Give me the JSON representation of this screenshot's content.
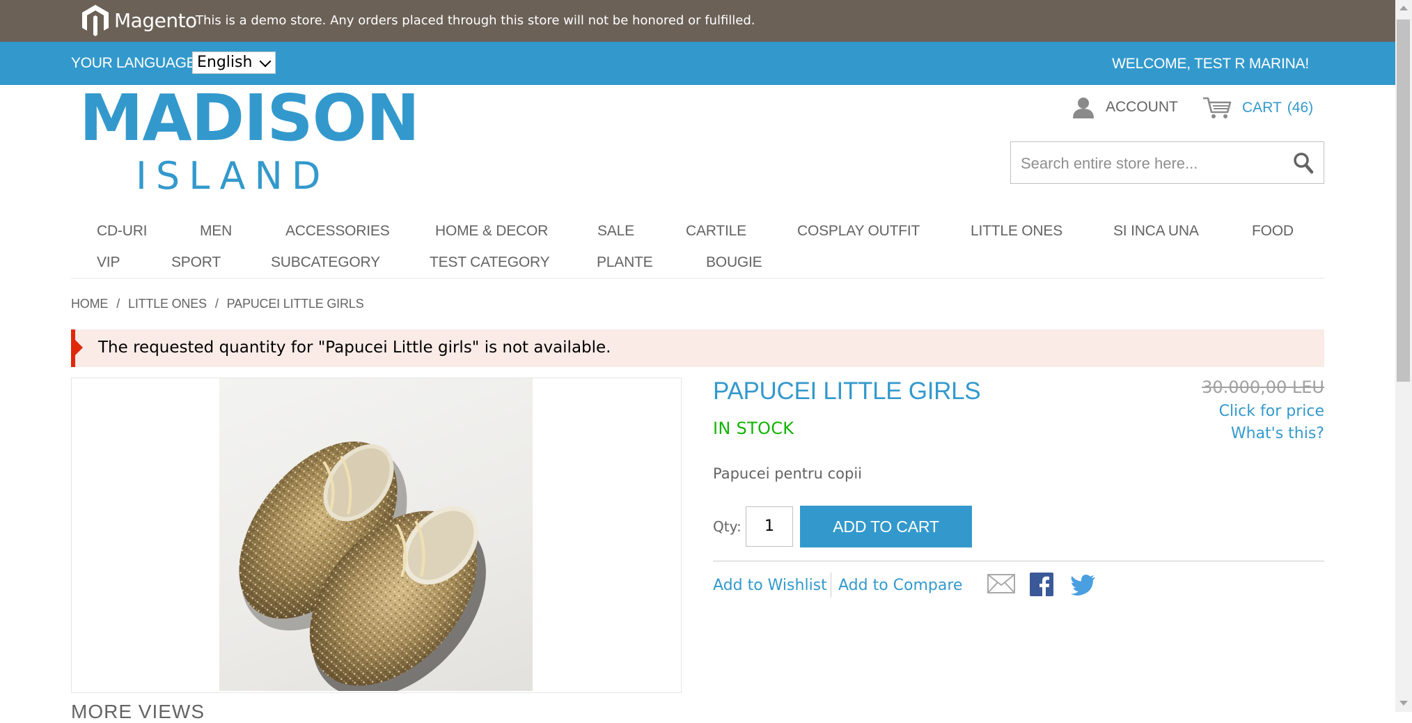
{
  "demo_notice": {
    "brand": "Magento",
    "text": "This is a demo store. Any orders placed through this store will not be honored or fulfilled."
  },
  "header": {
    "language_label": "YOUR LANGUAGE:",
    "language_selected": "English",
    "welcome": "WELCOME, TEST R MARINA!",
    "logo_line1": "MADISON",
    "logo_line2": "ISLAND",
    "account_label": "ACCOUNT",
    "cart_label": "CART",
    "cart_count": "(46)",
    "search_placeholder": "Search entire store here...",
    "icons": {
      "account": "user-icon",
      "cart": "cart-icon",
      "search": "search-icon"
    }
  },
  "nav": {
    "items": [
      "CD-URI",
      "MEN",
      "ACCESSORIES",
      "HOME & DECOR",
      "SALE",
      "CARTILE",
      "COSPLAY OUTFIT",
      "LITTLE ONES",
      "SI INCA UNA",
      "FOOD",
      "VIP",
      "SPORT",
      "SUBCATEGORY",
      "TEST CATEGORY",
      "PLANTE",
      "BOUGIE"
    ]
  },
  "breadcrumb": [
    "HOME",
    "LITTLE ONES",
    "PAPUCEI LITTLE GIRLS"
  ],
  "breadcrumb_separator": "/",
  "error_message": "The requested quantity for \"Papucei Little girls\" is not available.",
  "product": {
    "name": "PAPUCEI LITTLE GIRLS",
    "old_price": "30.000,00 LEU",
    "click_for_price": "Click for price",
    "whats_this": "What's this?",
    "stock": "IN STOCK",
    "short_description": "Papucei pentru copii",
    "qty_label": "Qty:",
    "qty_value": "1",
    "add_to_cart": "ADD TO CART",
    "add_to_wishlist": "Add to Wishlist",
    "add_to_compare": "Add to Compare",
    "share_icons": [
      "email-icon",
      "facebook-icon",
      "twitter-icon"
    ],
    "more_views": "MORE VIEWS"
  },
  "colors": {
    "demo_bar": "#6b6157",
    "brand_blue": "#3399cc",
    "error_bg": "#faebe7",
    "error_accent": "#df280a",
    "in_stock": "#11b400"
  }
}
